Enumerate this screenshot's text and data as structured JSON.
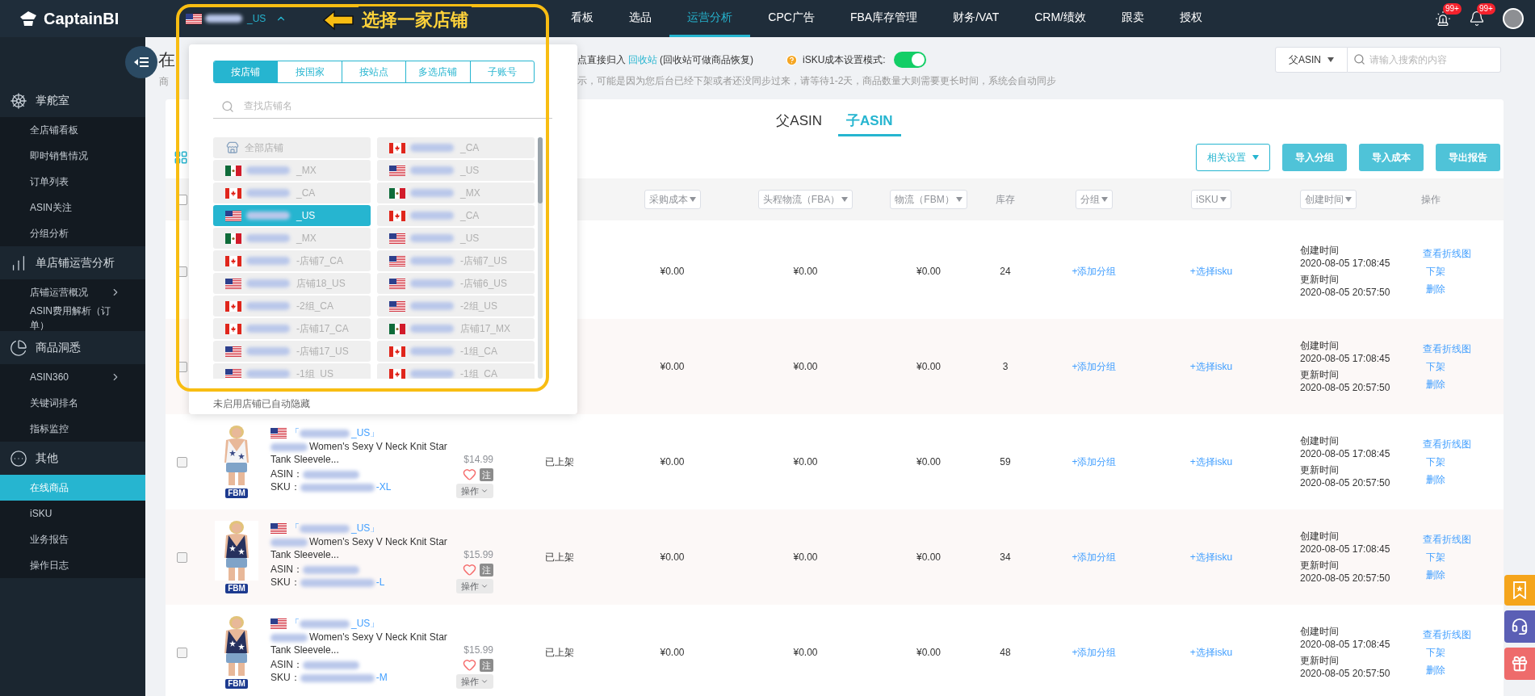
{
  "nav": {
    "logo": "CaptainBI",
    "store": {
      "kind": "us",
      "suffix": "_US"
    },
    "items": [
      {
        "label": "看板",
        "selected": false
      },
      {
        "label": "选品",
        "selected": false
      },
      {
        "label": "运营分析",
        "selected": true
      },
      {
        "label": "CPC广告",
        "selected": false
      },
      {
        "label": "FBA库存管理",
        "selected": false
      },
      {
        "label": "财务/VAT",
        "selected": false
      },
      {
        "label": "CRM/绩效",
        "selected": false
      },
      {
        "label": "跟卖",
        "selected": false
      },
      {
        "label": "授权",
        "selected": false
      }
    ],
    "alerts_badge": "99+",
    "notifications_badge": "99+"
  },
  "annotation": {
    "label": "选择一家店铺"
  },
  "sidebar": {
    "groups": [
      {
        "label": "掌舵室",
        "items": [
          {
            "label": "全店铺看板",
            "selected": false,
            "submenu": false
          },
          {
            "label": "即时销售情况",
            "selected": false,
            "submenu": false
          },
          {
            "label": "订单列表",
            "selected": false,
            "submenu": false
          },
          {
            "label": "ASIN关注",
            "selected": false,
            "submenu": false
          },
          {
            "label": "分组分析",
            "selected": false,
            "submenu": false
          }
        ]
      },
      {
        "label": "单店铺运营分析",
        "items": [
          {
            "label": "店铺运营概况",
            "selected": false,
            "submenu": true
          },
          {
            "label": "ASIN费用解析（订单）",
            "selected": false,
            "submenu": false
          }
        ]
      },
      {
        "label": "商品洞悉",
        "items": [
          {
            "label": "ASIN360",
            "selected": false,
            "submenu": true
          },
          {
            "label": "关键词排名",
            "selected": false,
            "submenu": false
          },
          {
            "label": "指标监控",
            "selected": false,
            "submenu": false
          }
        ]
      },
      {
        "label": "其他",
        "items": [
          {
            "label": "在线商品",
            "selected": true,
            "submenu": false
          },
          {
            "label": "iSKU",
            "selected": false,
            "submenu": false
          },
          {
            "label": "业务报告",
            "selected": false,
            "submenu": false
          },
          {
            "label": "操作日志",
            "selected": false,
            "submenu": false
          }
        ]
      }
    ]
  },
  "header": {
    "title_fragment": "在",
    "hint_fragment": "商",
    "notice": {
      "before": "点直接归入",
      "link": "回收站",
      "after": "(回收站可做商品恢复)"
    },
    "isku_mode": {
      "label": "iSKU成本设置模式:",
      "on": true
    },
    "sync_notice": "示，可能是因为您后台已经下架或者还没同步过来，请等待1-2天，商品数量大则需要更长时间，系统会自动同步",
    "search": {
      "scope": "父ASIN",
      "placeholder": "请输入搜索的内容"
    }
  },
  "asin_tabs": [
    {
      "label": "父ASIN",
      "selected": false
    },
    {
      "label": "子ASIN",
      "selected": true
    }
  ],
  "toolbar": {
    "settings": "相关设置",
    "buttons": [
      "导入分组",
      "导入成本",
      "导出报告"
    ]
  },
  "table": {
    "select_all_checked": false,
    "columns": [
      {
        "label": "采购成本",
        "filter": true
      },
      {
        "label": "头程物流（FBA）",
        "filter": true
      },
      {
        "label": "物流（FBM）",
        "filter": true
      },
      {
        "label": "库存",
        "filter": false
      },
      {
        "label": "分组",
        "filter": true
      },
      {
        "label": "iSKU",
        "filter": true
      },
      {
        "label": "创建时间",
        "filter": true
      },
      {
        "label": "操作",
        "filter": false
      }
    ],
    "rows": [
      {
        "purchase": "¥0.00",
        "fba": "¥0.00",
        "fbm": "¥0.00",
        "stock": "24",
        "checked": false,
        "group": "+添加分组",
        "isku": "+选择isku",
        "created_label": "创建时间",
        "created": "2020-08-05 17:08:45",
        "updated_label": "更新时间",
        "updated": "2020-08-05 20:57:50",
        "actions": [
          "查看折线图",
          "下架",
          "删除"
        ]
      },
      {
        "purchase": "¥0.00",
        "fba": "¥0.00",
        "fbm": "¥0.00",
        "stock": "3",
        "checked": false,
        "group": "+添加分组",
        "isku": "+选择isku",
        "created_label": "创建时间",
        "created": "2020-08-05 17:08:45",
        "updated_label": "更新时间",
        "updated": "2020-08-05 20:57:50",
        "actions": [
          "查看折线图",
          "下架",
          "删除"
        ]
      },
      {
        "product": {
          "store_suffix": "_US",
          "title": "Women's Sexy V Neck Knit Star Tank Sleevele...",
          "price": "$14.99",
          "asin_label": "ASIN：",
          "sku_label": "SKU：",
          "sku_suffix": "-XL",
          "badge": "FBM",
          "note": "注",
          "menu": "操作",
          "store_open": "「",
          "store_close": "」"
        },
        "status": "已上架",
        "checked": false,
        "purchase": "¥0.00",
        "fba": "¥0.00",
        "fbm": "¥0.00",
        "stock": "59",
        "group": "+添加分组",
        "isku": "+选择isku",
        "created_label": "创建时间",
        "created": "2020-08-05 17:08:45",
        "updated_label": "更新时间",
        "updated": "2020-08-05 20:57:50",
        "actions": [
          "查看折线图",
          "下架",
          "删除"
        ]
      },
      {
        "product": {
          "store_suffix": "_US",
          "title": "Women's Sexy V Neck Knit Star Tank Sleevele...",
          "price": "$15.99",
          "asin_label": "ASIN：",
          "sku_label": "SKU：",
          "sku_suffix": "-L",
          "badge": "FBM",
          "note": "注",
          "menu": "操作",
          "store_open": "「",
          "store_close": "」"
        },
        "status": "已上架",
        "checked": false,
        "purchase": "¥0.00",
        "fba": "¥0.00",
        "fbm": "¥0.00",
        "stock": "34",
        "group": "+添加分组",
        "isku": "+选择isku",
        "created_label": "创建时间",
        "created": "2020-08-05 17:08:45",
        "updated_label": "更新时间",
        "updated": "2020-08-05 20:57:50",
        "actions": [
          "查看折线图",
          "下架",
          "删除"
        ]
      },
      {
        "product": {
          "store_suffix": "_US",
          "title": "Women's Sexy V Neck Knit Star Tank Sleevele...",
          "price": "$15.99",
          "asin_label": "ASIN：",
          "sku_label": "SKU：",
          "sku_suffix": "-M",
          "badge": "FBM",
          "note": "注",
          "menu": "操作",
          "store_open": "「",
          "store_close": "」"
        },
        "status": "已上架",
        "checked": false,
        "purchase": "¥0.00",
        "fba": "¥0.00",
        "fbm": "¥0.00",
        "stock": "48",
        "group": "+添加分组",
        "isku": "+选择isku",
        "created_label": "创建时间",
        "created": "2020-08-05 17:08:45",
        "updated_label": "更新时间",
        "updated": "2020-08-05 20:57:50",
        "actions": [
          "查看折线图",
          "下架",
          "删除"
        ]
      }
    ]
  },
  "store_picker": {
    "tabs": [
      {
        "label": "按店铺",
        "selected": true
      },
      {
        "label": "按国家",
        "selected": false
      },
      {
        "label": "按站点",
        "selected": false
      },
      {
        "label": "多选店铺",
        "selected": false
      },
      {
        "label": "子账号",
        "selected": false
      }
    ],
    "search_placeholder": "查找店铺名",
    "stores": [
      {
        "kind": "all",
        "name": "全部店铺",
        "selected": false
      },
      {
        "kind": "ca",
        "name": "_CA",
        "selected": false
      },
      {
        "kind": "mx",
        "name": "_MX",
        "selected": false
      },
      {
        "kind": "us",
        "name": "_US",
        "selected": false
      },
      {
        "kind": "ca",
        "name": "_CA",
        "selected": false
      },
      {
        "kind": "mx",
        "name": "_MX",
        "selected": false
      },
      {
        "kind": "us",
        "name": "_US",
        "selected": true
      },
      {
        "kind": "ca",
        "name": "_CA",
        "selected": false
      },
      {
        "kind": "mx",
        "name": "_MX",
        "selected": false
      },
      {
        "kind": "us",
        "name": "_US",
        "selected": false
      },
      {
        "kind": "ca",
        "name": "-店铺7_CA",
        "selected": false
      },
      {
        "kind": "us",
        "name": "-店铺7_US",
        "selected": false
      },
      {
        "kind": "us",
        "name": "店铺18_US",
        "selected": false
      },
      {
        "kind": "us",
        "name": "-店铺6_US",
        "selected": false
      },
      {
        "kind": "ca",
        "name": "-2组_CA",
        "selected": false
      },
      {
        "kind": "us",
        "name": "-2组_US",
        "selected": false
      },
      {
        "kind": "ca",
        "name": "-店铺17_CA",
        "selected": false
      },
      {
        "kind": "mx",
        "name": "店铺17_MX",
        "selected": false
      },
      {
        "kind": "us",
        "name": "-店铺17_US",
        "selected": false
      },
      {
        "kind": "ca",
        "name": "-1组_CA",
        "selected": false
      },
      {
        "kind": "us",
        "name": "-1组_US",
        "selected": false
      },
      {
        "kind": "ca",
        "name": "-1组_CA",
        "selected": false
      }
    ],
    "footnote": "未启用店铺已自动隐藏"
  }
}
